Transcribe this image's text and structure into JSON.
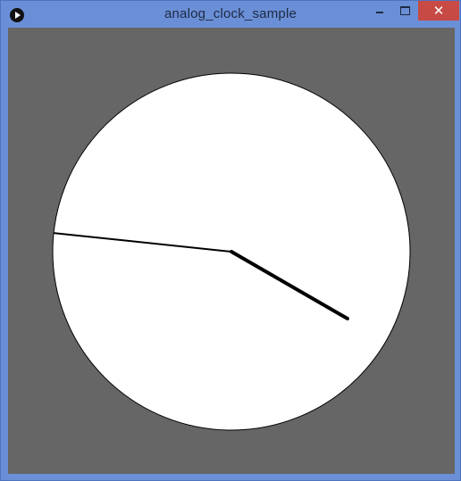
{
  "window": {
    "title": "analog_clock_sample",
    "controls": {
      "minimize_icon": "minimize-icon",
      "maximize_icon": "maximize-icon",
      "close_label": "✕"
    }
  },
  "clock": {
    "background_color": "#666666",
    "face_color": "#ffffff",
    "outline_color": "#000000",
    "hand_color": "#000000",
    "time_shown": {
      "hour_hand_angle_deg": 120,
      "minute_hand_angle_deg": 276
    }
  }
}
